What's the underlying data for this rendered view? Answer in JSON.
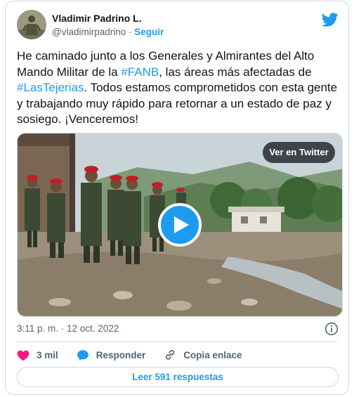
{
  "author": {
    "name": "Vladimir Padrino L.",
    "handle": "@vladimirpadrino",
    "separator": " · ",
    "follow_label": "Seguir"
  },
  "tweet": {
    "text_part1": "He caminado junto a los Generales y Almirantes del Alto Mando Militar de la ",
    "hashtag1": "#FANB",
    "text_part2": ", las áreas más afectadas de ",
    "hashtag2": "#LasTejerias",
    "text_part3": ". Todos estamos comprometidos con esta gente y trabajando muy rápido para retornar a un estado de paz y sosiego. ¡Venceremos!"
  },
  "media": {
    "view_on_twitter_label": "Ver en Twitter"
  },
  "meta": {
    "timestamp": "3:11 p. m. · 12 oct. 2022"
  },
  "actions": {
    "likes": "3 mil",
    "reply_label": "Responder",
    "copy_link_label": "Copia enlace"
  },
  "replies_button": "Leer 591 respuestas",
  "colors": {
    "accent": "#1d9bf0",
    "like": "#f91880",
    "text": "#0f1419",
    "muted": "#536471",
    "border": "#cfd9de"
  }
}
